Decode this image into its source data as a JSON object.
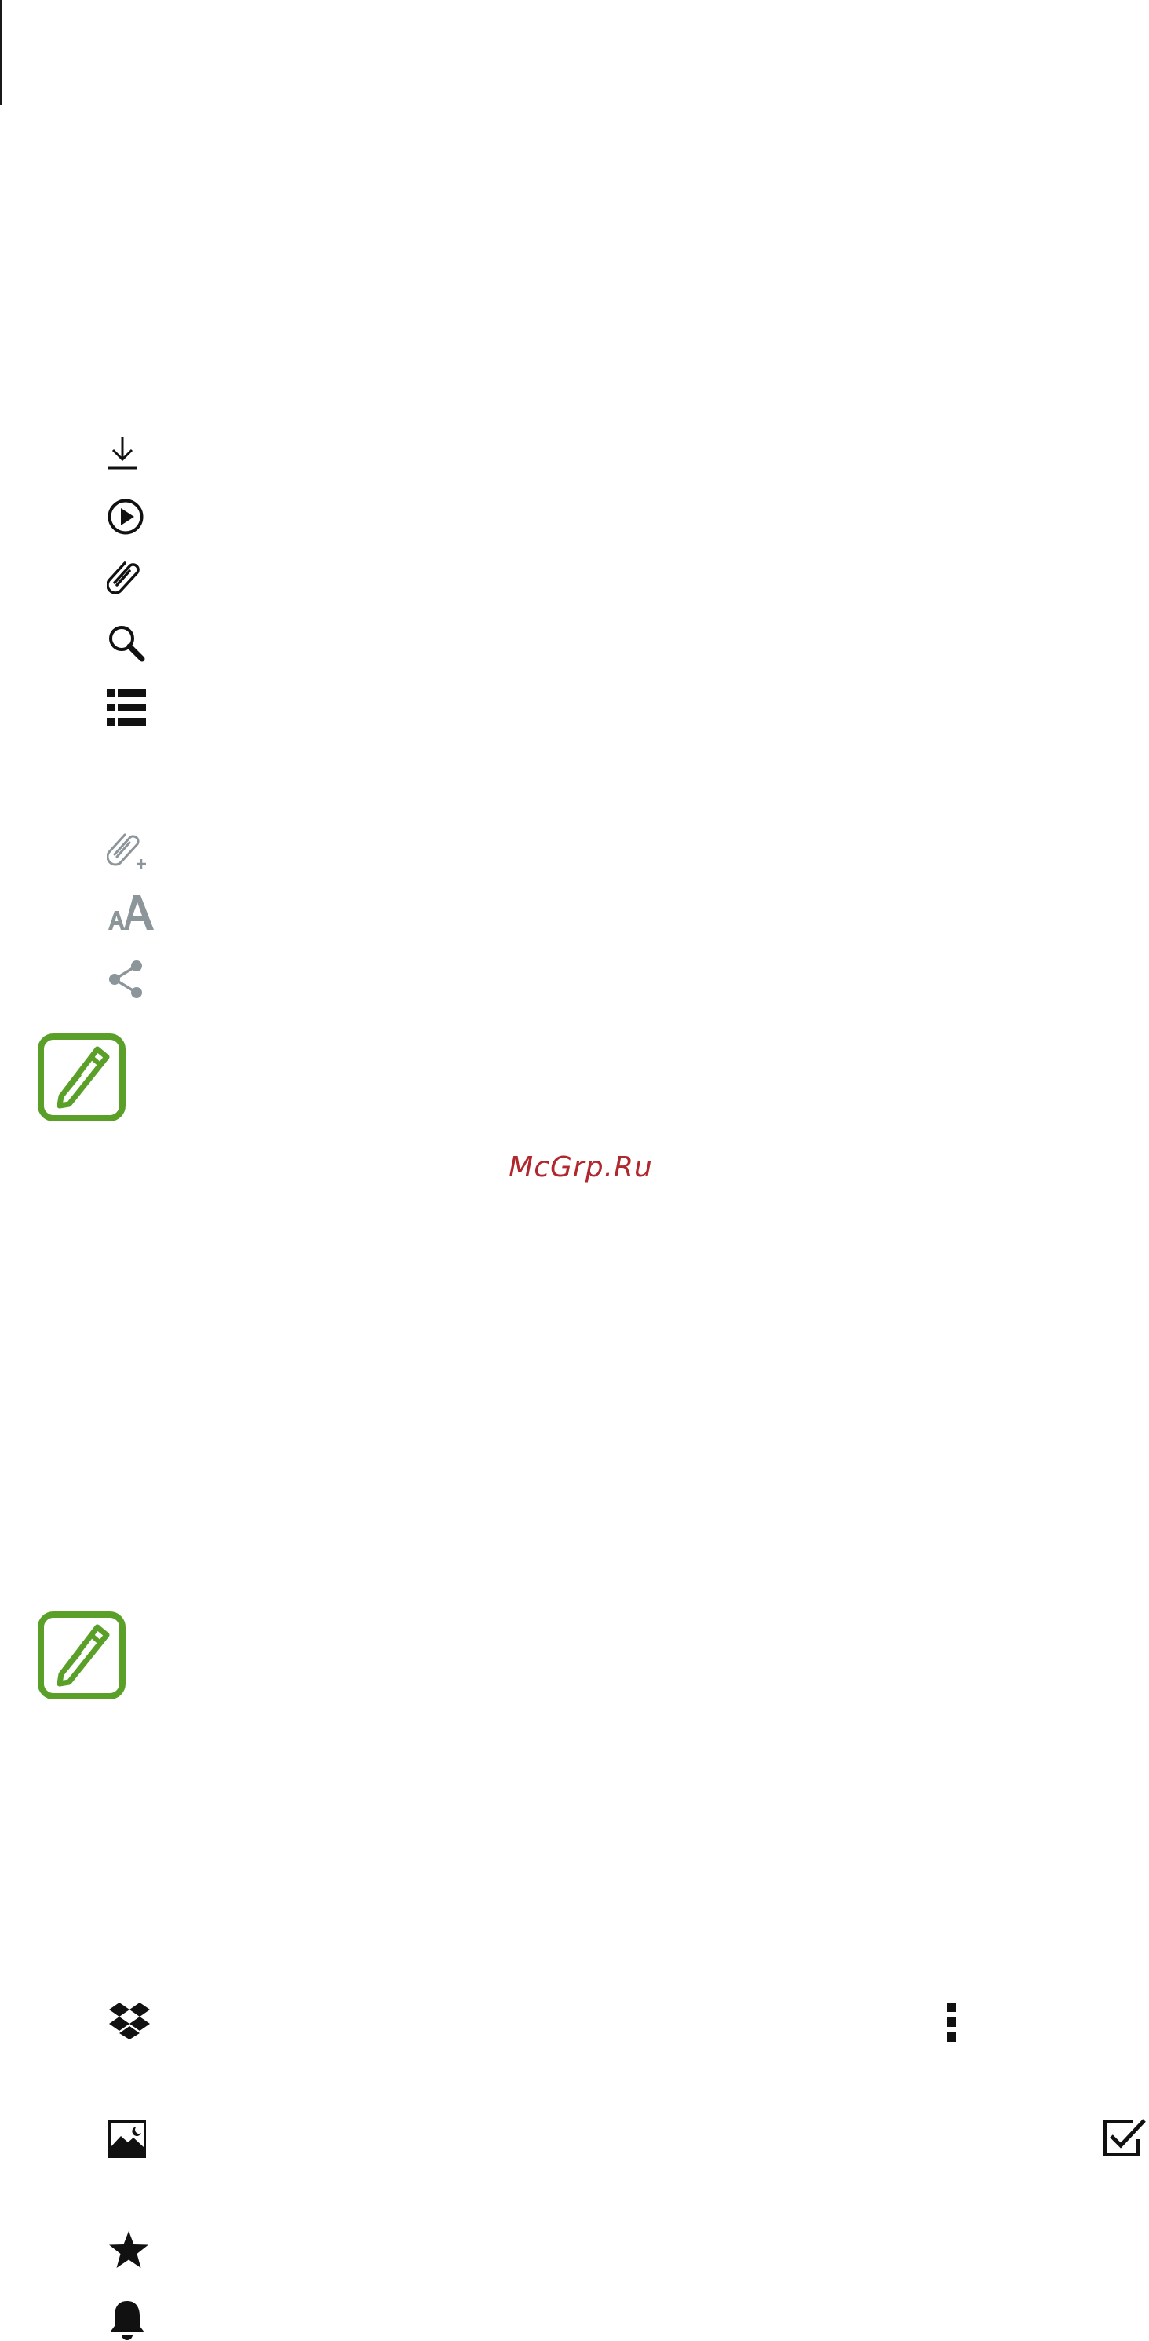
{
  "watermark": {
    "text": "McGrp.Ru",
    "color": "#b0272d"
  },
  "colors": {
    "icon_dark": "#111111",
    "icon_gray": "#8c9599",
    "note_green": "#5aa028"
  },
  "icons": {
    "group_1": [
      "download-icon",
      "play-circle-icon",
      "attach-icon",
      "search-icon",
      "list-view-icon"
    ],
    "group_2": [
      "attach-add-icon",
      "font-size-icon",
      "share-icon"
    ],
    "group_3": [
      "dropbox-icon",
      "more-options-icon",
      "image-icon",
      "checkbox-checked-icon",
      "star-icon",
      "bell-icon"
    ],
    "notes": [
      "note-pencil-icon",
      "note-pencil-icon"
    ]
  }
}
